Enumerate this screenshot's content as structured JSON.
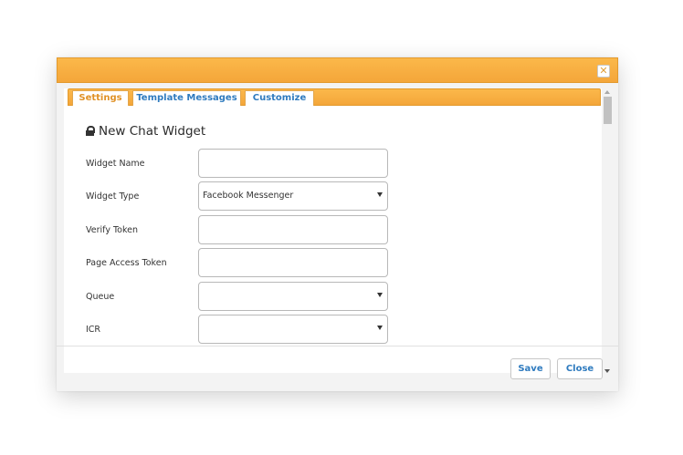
{
  "dialog": {
    "close_glyph": "✕"
  },
  "tabs": [
    {
      "label": "Settings",
      "active": true
    },
    {
      "label": "Template Messages",
      "active": false
    },
    {
      "label": "Customize",
      "active": false
    }
  ],
  "panel": {
    "heading": "New Chat Widget",
    "heading_icon": "lock-icon"
  },
  "form": {
    "fields": [
      {
        "label": "Widget Name",
        "type": "text",
        "value": ""
      },
      {
        "label": "Widget Type",
        "type": "select",
        "value": "Facebook Messenger"
      },
      {
        "label": "Verify Token",
        "type": "text",
        "value": ""
      },
      {
        "label": "Page Access Token",
        "type": "text",
        "value": ""
      },
      {
        "label": "Queue",
        "type": "select",
        "value": ""
      },
      {
        "label": "ICR",
        "type": "select",
        "value": ""
      }
    ]
  },
  "footer": {
    "save_label": "Save",
    "close_label": "Close"
  },
  "colors": {
    "accent_orange": "#f4a63a",
    "link_blue": "#2f7bbf",
    "active_tab_text": "#e09227"
  }
}
